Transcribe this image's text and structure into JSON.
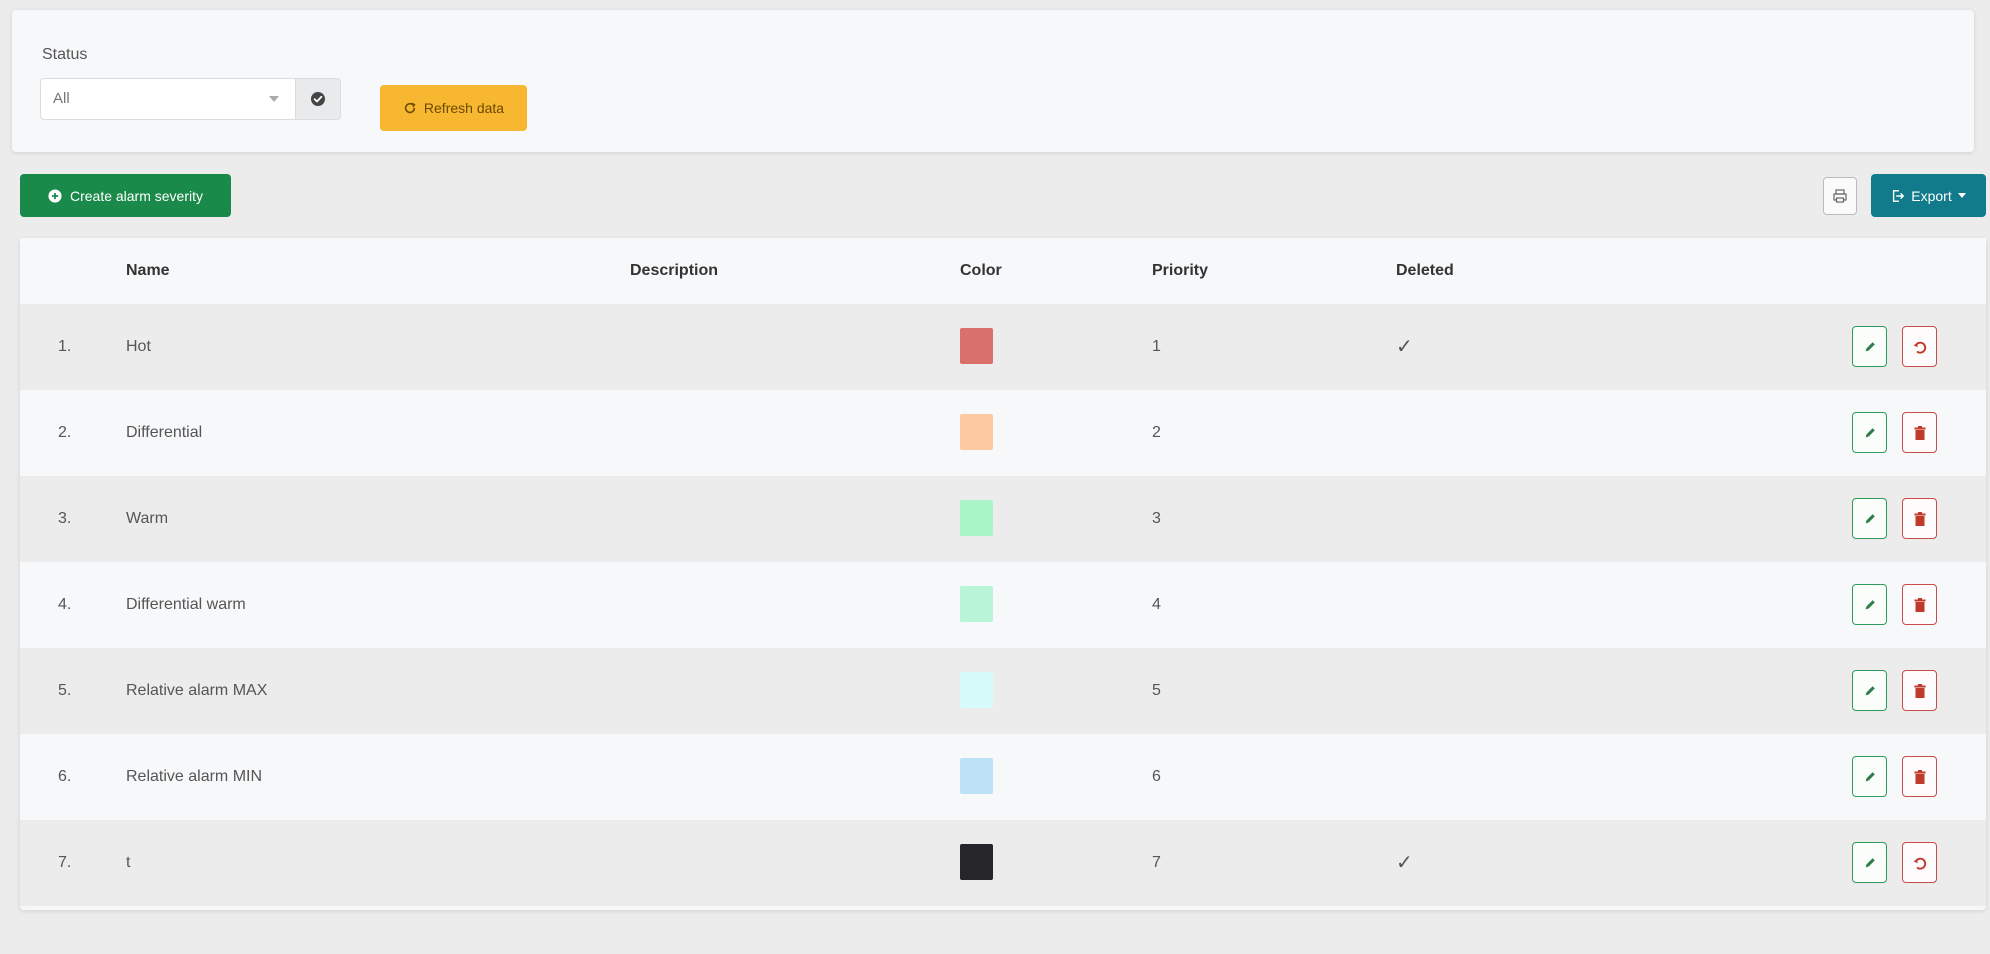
{
  "filter": {
    "status_label": "Status",
    "status_value": "All",
    "refresh_label": "Refresh data"
  },
  "toolbar": {
    "create_label": "Create alarm severity",
    "export_label": "Export"
  },
  "table": {
    "columns": [
      "Name",
      "Description",
      "Color",
      "Priority",
      "Deleted"
    ],
    "rows": [
      {
        "index": "1.",
        "name": "Hot",
        "description": "",
        "color": "#d9706c",
        "priority": "1",
        "deleted": "✓"
      },
      {
        "index": "2.",
        "name": "Differential",
        "description": "",
        "color": "#fcc9a0",
        "priority": "2",
        "deleted": ""
      },
      {
        "index": "3.",
        "name": "Warm",
        "description": "",
        "color": "#aaf5c7",
        "priority": "3",
        "deleted": ""
      },
      {
        "index": "4.",
        "name": "Differential warm",
        "description": "",
        "color": "#b9f4d6",
        "priority": "4",
        "deleted": ""
      },
      {
        "index": "5.",
        "name": "Relative alarm MAX",
        "description": "",
        "color": "#d7fbfb",
        "priority": "5",
        "deleted": ""
      },
      {
        "index": "6.",
        "name": "Relative alarm MIN",
        "description": "",
        "color": "#bde2f7",
        "priority": "6",
        "deleted": ""
      },
      {
        "index": "7.",
        "name": "t",
        "description": "",
        "color": "#25252a",
        "priority": "7",
        "deleted": "✓"
      }
    ]
  },
  "icons": {
    "status_addon": "check-circle-icon",
    "refresh": "refresh-icon",
    "create": "plus-circle-icon",
    "print": "print-icon",
    "export": "export-icon",
    "edit": "pencil-icon",
    "delete": "trash-icon",
    "restore": "undo-icon"
  },
  "colors": {
    "create_button": "#1a8a4a",
    "refresh_button": "#f7b731",
    "export_button": "#117a8b",
    "edit_border": "#2d9b5c",
    "delete_border": "#c94b4b"
  }
}
